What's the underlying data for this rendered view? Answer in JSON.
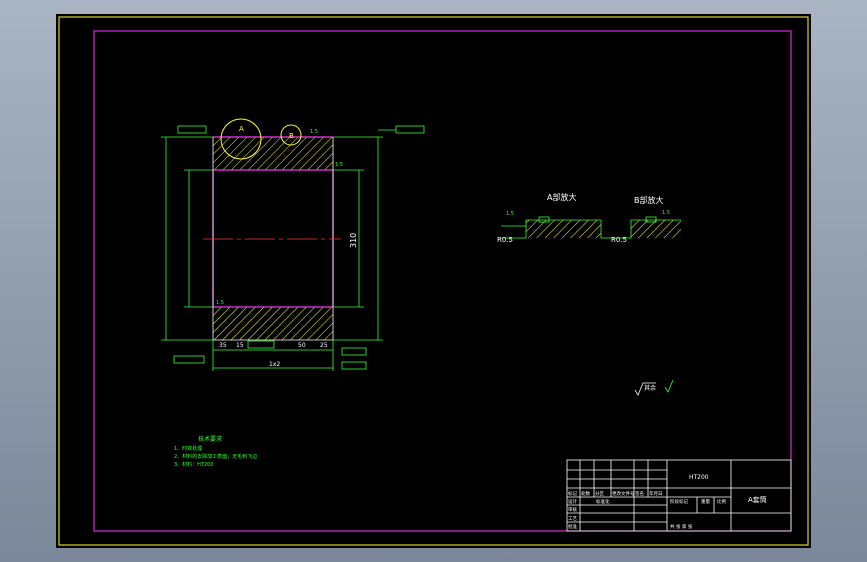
{
  "colors": {
    "background": "#000000",
    "frame": "#ffffff",
    "inner_border": "#ff33ff",
    "outer_border": "#ffff33",
    "dimension": "#33ff33",
    "hatch": "#ffff33",
    "center_line": "#ff3333"
  },
  "section_view": {
    "dim_height": "310",
    "dim_left": "35",
    "dim_left2": "15",
    "dim_right": "50",
    "dim_right2": "25",
    "dim_bottom": "1x2",
    "roughness_mark": "1.5",
    "circle_a": "A",
    "circle_b": "B"
  },
  "details": {
    "detail_a_title": "A部放大",
    "detail_b_title": "B部放大",
    "radius_a": "R0.5",
    "radius_b": "R0.5",
    "roughness_a": "1.5",
    "roughness_b": "1.5"
  },
  "surface_symbol": "其余",
  "notes": {
    "title": "技术要求",
    "lines": [
      "1、时效处理",
      "2、材料的去除加工表面，无毛刺飞边",
      "3、材料：HT200"
    ]
  },
  "title_block": {
    "material": "HT200",
    "part_name": "A套筒",
    "headers": [
      "标记",
      "处数",
      "分区",
      "更改文件号",
      "签名",
      "年月日"
    ],
    "rows": [
      "设计",
      "审核",
      "工艺",
      "批准"
    ],
    "labels": [
      "标准化",
      "阶段标记",
      "重量",
      "比例"
    ],
    "sheet_text": "共  张  第  张"
  }
}
